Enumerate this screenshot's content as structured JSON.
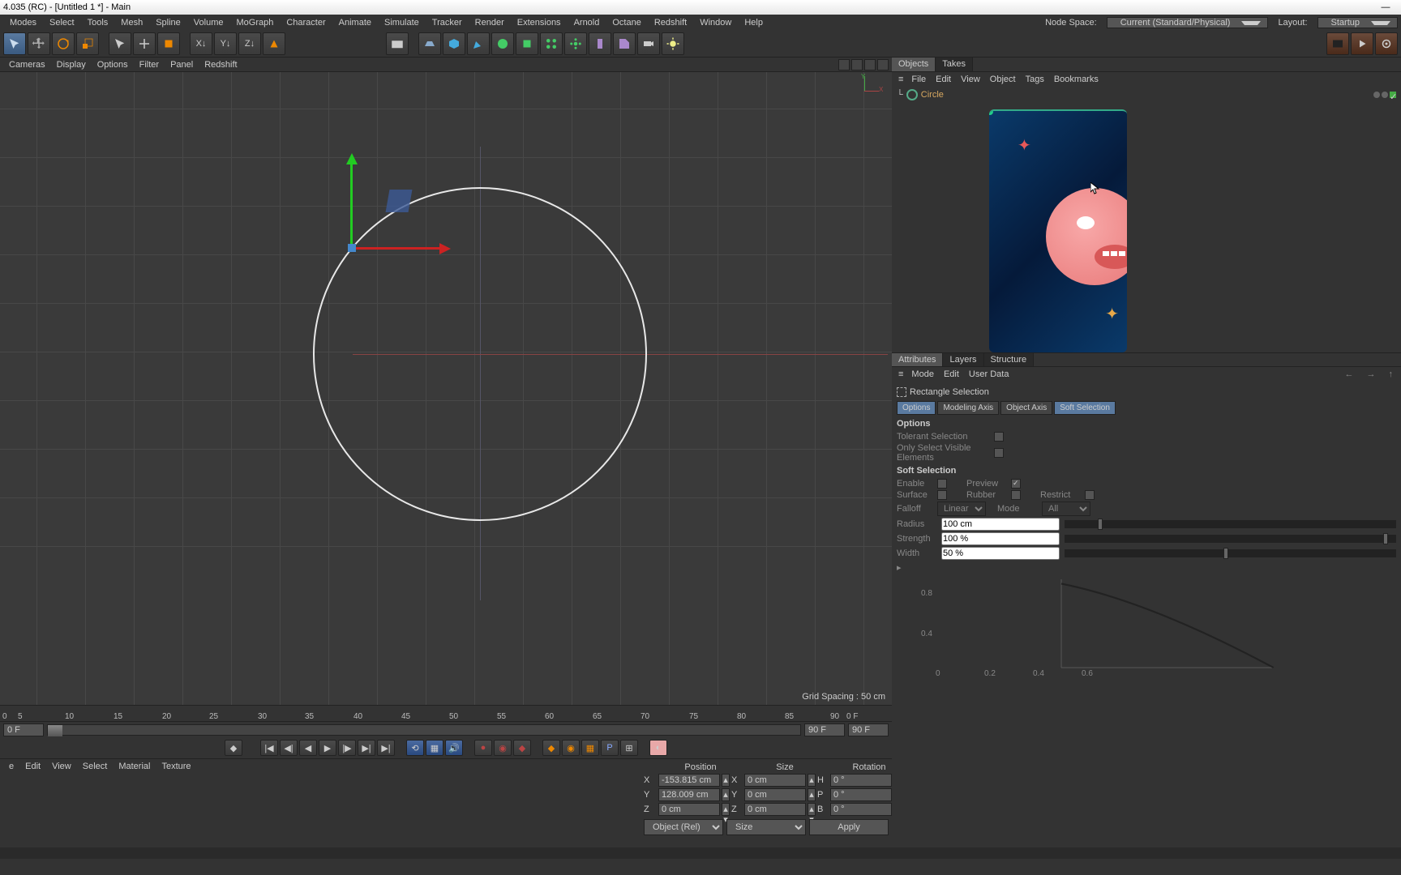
{
  "title": "4.035 (RC) - [Untitled 1 *] - Main",
  "menu": [
    "Modes",
    "Select",
    "Tools",
    "Mesh",
    "Spline",
    "Volume",
    "MoGraph",
    "Character",
    "Animate",
    "Simulate",
    "Tracker",
    "Render",
    "Extensions",
    "Arnold",
    "Octane",
    "Redshift",
    "Window",
    "Help"
  ],
  "menu_right": {
    "node_space": "Node Space:",
    "node_space_val": "Current (Standard/Physical)",
    "layout": "Layout:",
    "layout_val": "Startup"
  },
  "viewport_menu": [
    "Cameras",
    "Display",
    "Options",
    "Filter",
    "Panel",
    "Redshift"
  ],
  "axis": {
    "y": "Y",
    "x": "X"
  },
  "grid_spacing": "Grid Spacing : 50 cm",
  "timeline_ticks": [
    "5",
    "10",
    "15",
    "20",
    "25",
    "30",
    "35",
    "40",
    "45",
    "50",
    "55",
    "60",
    "65",
    "70",
    "75",
    "80",
    "85",
    "90"
  ],
  "timeline": {
    "start": "0 F",
    "end": "90 F",
    "end2": "90 F",
    "start_marker": "0",
    "end_marker": "90"
  },
  "material_menu": [
    "e",
    "Edit",
    "View",
    "Select",
    "Material",
    "Texture"
  ],
  "coord": {
    "headers": [
      "Position",
      "Size",
      "Rotation"
    ],
    "x": "X",
    "y": "Y",
    "z": "Z",
    "h": "H",
    "p": "P",
    "b": "B",
    "pos_x": "-153.815 cm",
    "pos_y": "128.009 cm",
    "pos_z": "0 cm",
    "size_x": "0 cm",
    "size_y": "0 cm",
    "size_z": "0 cm",
    "rot_h": "0 °",
    "rot_p": "0 °",
    "rot_b": "0 °",
    "object_rel": "Object (Rel)",
    "size_mode": "Size",
    "apply": "Apply"
  },
  "obj_tabs": [
    "Objects",
    "Takes"
  ],
  "obj_menu": [
    "File",
    "Edit",
    "View",
    "Object",
    "Tags",
    "Bookmarks"
  ],
  "tree": {
    "circle": "Circle"
  },
  "attr_tabs": [
    "Attributes",
    "Layers",
    "Structure"
  ],
  "attr_menu": [
    "Mode",
    "Edit",
    "User Data"
  ],
  "attr": {
    "tool_name": "Rectangle Selection",
    "mode_tabs": [
      "Options",
      "Modeling Axis",
      "Object Axis",
      "Soft Selection"
    ],
    "options_head": "Options",
    "tolerant": "Tolerant Selection",
    "only_visible": "Only Select Visible Elements",
    "soft_head": "Soft Selection",
    "enable": "Enable",
    "preview": "Preview",
    "surface": "Surface",
    "rubber": "Rubber",
    "restrict": "Restrict",
    "falloff": "Falloff",
    "falloff_val": "Linear",
    "mode": "Mode",
    "mode_val": "All",
    "radius": "Radius",
    "radius_val": "100 cm",
    "strength": "Strength",
    "strength_val": "100 %",
    "width": "Width",
    "width_val": "50 %"
  },
  "chart_data": {
    "type": "line",
    "x": [
      0,
      0.2,
      0.4,
      0.6,
      0.8,
      1.0
    ],
    "y": [
      1.0,
      0.82,
      0.62,
      0.4,
      0.19,
      0.0
    ],
    "y_ticks": [
      0.4,
      0.8
    ],
    "x_ticks": [
      0.0,
      0.2,
      0.4,
      0.6
    ],
    "ylim": [
      0,
      1
    ],
    "xlim": [
      0,
      1
    ]
  }
}
